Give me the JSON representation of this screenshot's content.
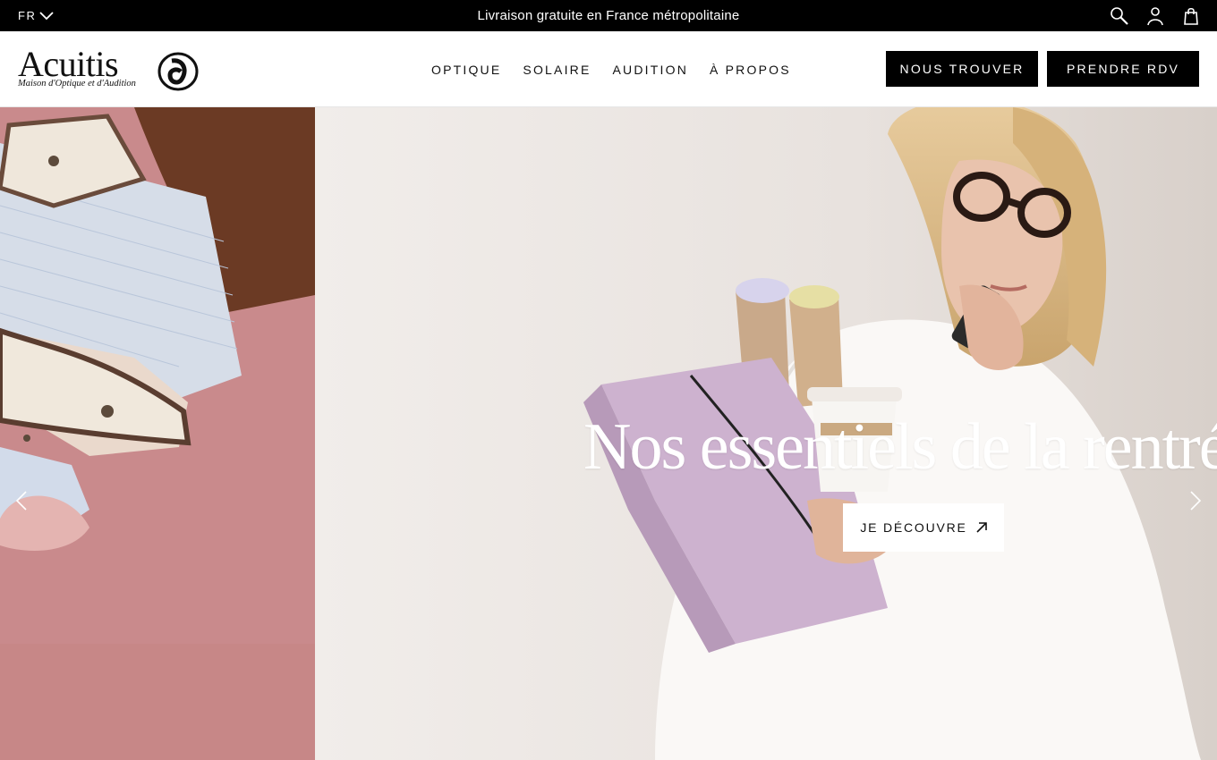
{
  "topbar": {
    "language": "FR",
    "announcement": "Livraison gratuite en France métropolitaine"
  },
  "header": {
    "logo": {
      "wordmark": "Acuitis",
      "tagline": "Maison d'Optique et d'Audition"
    },
    "nav": [
      {
        "label": "OPTIQUE"
      },
      {
        "label": "SOLAIRE"
      },
      {
        "label": "AUDITION"
      },
      {
        "label": "À PROPOS"
      }
    ],
    "buttons": {
      "find": "NOUS TROUVER",
      "appointment": "PRENDRE RDV"
    }
  },
  "hero": {
    "title": "Nos essentiels de la rentrée",
    "cta": "JE DÉCOUVRE"
  },
  "colors": {
    "topbar_bg": "#000000",
    "button_bg": "#000000",
    "left_panel_bg": "#c98a8c",
    "cta_bg": "#ffffff"
  },
  "icons": [
    "chevron-down-icon",
    "search-icon",
    "user-icon",
    "shopping-bag-icon",
    "external-arrow-icon",
    "chevron-left-icon",
    "chevron-right-icon"
  ]
}
